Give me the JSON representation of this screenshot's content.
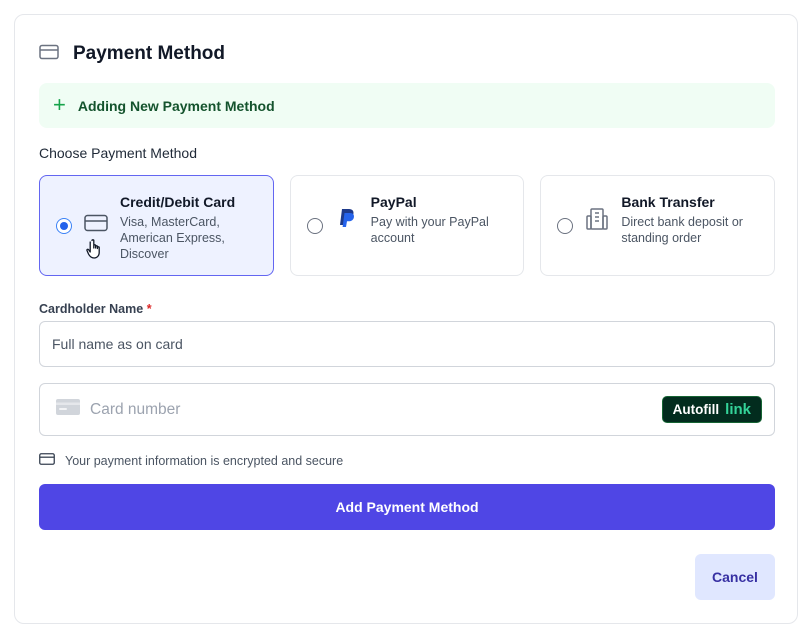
{
  "header": {
    "title": "Payment Method",
    "icon": "credit-card-icon"
  },
  "banner": {
    "text": "Adding New Payment Method",
    "icon": "plus-icon",
    "color": "#16a34a"
  },
  "choose_label": "Choose Payment Method",
  "methods": [
    {
      "title": "Credit/Debit Card",
      "description": "Visa, MasterCard, American Express, Discover",
      "icon": "credit-card-icon",
      "selected": true
    },
    {
      "title": "PayPal",
      "description": "Pay with your PayPal account",
      "icon": "paypal-icon",
      "selected": false
    },
    {
      "title": "Bank Transfer",
      "description": "Direct bank deposit or standing order",
      "icon": "bank-building-icon",
      "selected": false
    }
  ],
  "cardholder": {
    "label": "Cardholder Name",
    "required_mark": "*",
    "value": "",
    "placeholder": "Full name as on card"
  },
  "card_number": {
    "value": "",
    "placeholder": "Card number",
    "autofill_label": "Autofill",
    "autofill_brand": "link"
  },
  "secure_note": "Your payment information is encrypted and secure",
  "buttons": {
    "add": "Add Payment Method",
    "cancel": "Cancel"
  },
  "colors": {
    "primary": "#4f46e5",
    "selected_bg": "#eef2ff",
    "banner_bg": "#f0fdf4",
    "required": "#dc2626"
  }
}
